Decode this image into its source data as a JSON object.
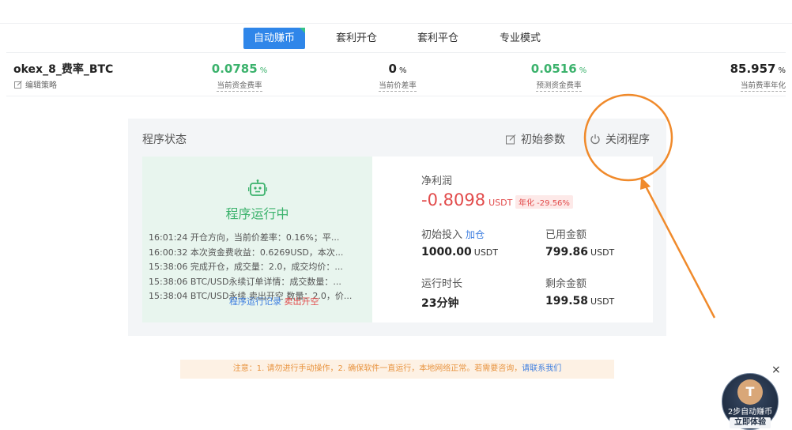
{
  "tabs": [
    {
      "label": "自动赚币",
      "active": true
    },
    {
      "label": "套利开仓",
      "active": false
    },
    {
      "label": "套利平仓",
      "active": false
    },
    {
      "label": "专业模式",
      "active": false
    }
  ],
  "strategy": {
    "name": "okex_8_费率_BTC",
    "edit_label": "编辑策略"
  },
  "stats": [
    {
      "value": "0.0785",
      "unit": "%",
      "label": "当前资金费率",
      "color": "#3bb26c"
    },
    {
      "value": "0",
      "unit": "%",
      "label": "当前价差率",
      "color": "#222222"
    },
    {
      "value": "0.0516",
      "unit": "%",
      "label": "预测资金费率",
      "color": "#3bb26c"
    },
    {
      "value": "85.957",
      "unit": "%",
      "label": "当前费率年化",
      "color": "#222222"
    }
  ],
  "panel": {
    "title": "程序状态",
    "init_params_label": "初始参数",
    "close_program_label": "关闭程序"
  },
  "running": {
    "status_text": "程序运行中",
    "logs": [
      "16:01:24 开仓方向，当前价差率：0.16%；平...",
      "16:00:32 本次资金费收益：0.6269USD，本次...",
      "15:38:06 完成开仓，成交量：2.0，成交均价：...",
      "15:38:06 BTC/USD永续订单详情：成交数量：...",
      "15:38:04 BTC/USD永续 卖出开空 数量：2.0，价..."
    ],
    "overlay_blue": "程序运行记录",
    "overlay_red": "卖出开空"
  },
  "info": {
    "net_profit_label": "净利润",
    "net_profit_value": "-0.8098",
    "net_profit_unit": "USDT",
    "annual_badge": "年化 -29.56%",
    "initial_label": "初始投入",
    "add_label": "加仓",
    "initial_value": "1000.00",
    "used_label": "已用金额",
    "used_value": "799.86",
    "runtime_label": "运行时长",
    "runtime_value": "23分钟",
    "remaining_label": "剩余金额",
    "remaining_value": "199.58",
    "unit": "USDT"
  },
  "notice": {
    "text": "注意：1. 请勿进行手动操作，2. 确保软件一直运行，本地网络正常。若需要咨询，",
    "link": "请联系我们"
  },
  "promo": {
    "coin_symbol": "T",
    "text": "2步自动赚币",
    "button": "立即体验",
    "close": "×"
  },
  "colors": {
    "accent_blue": "#2f86e9",
    "profit_green": "#3bb26c",
    "loss_red": "#e24b4b",
    "annotation_orange": "#f08a2b"
  }
}
